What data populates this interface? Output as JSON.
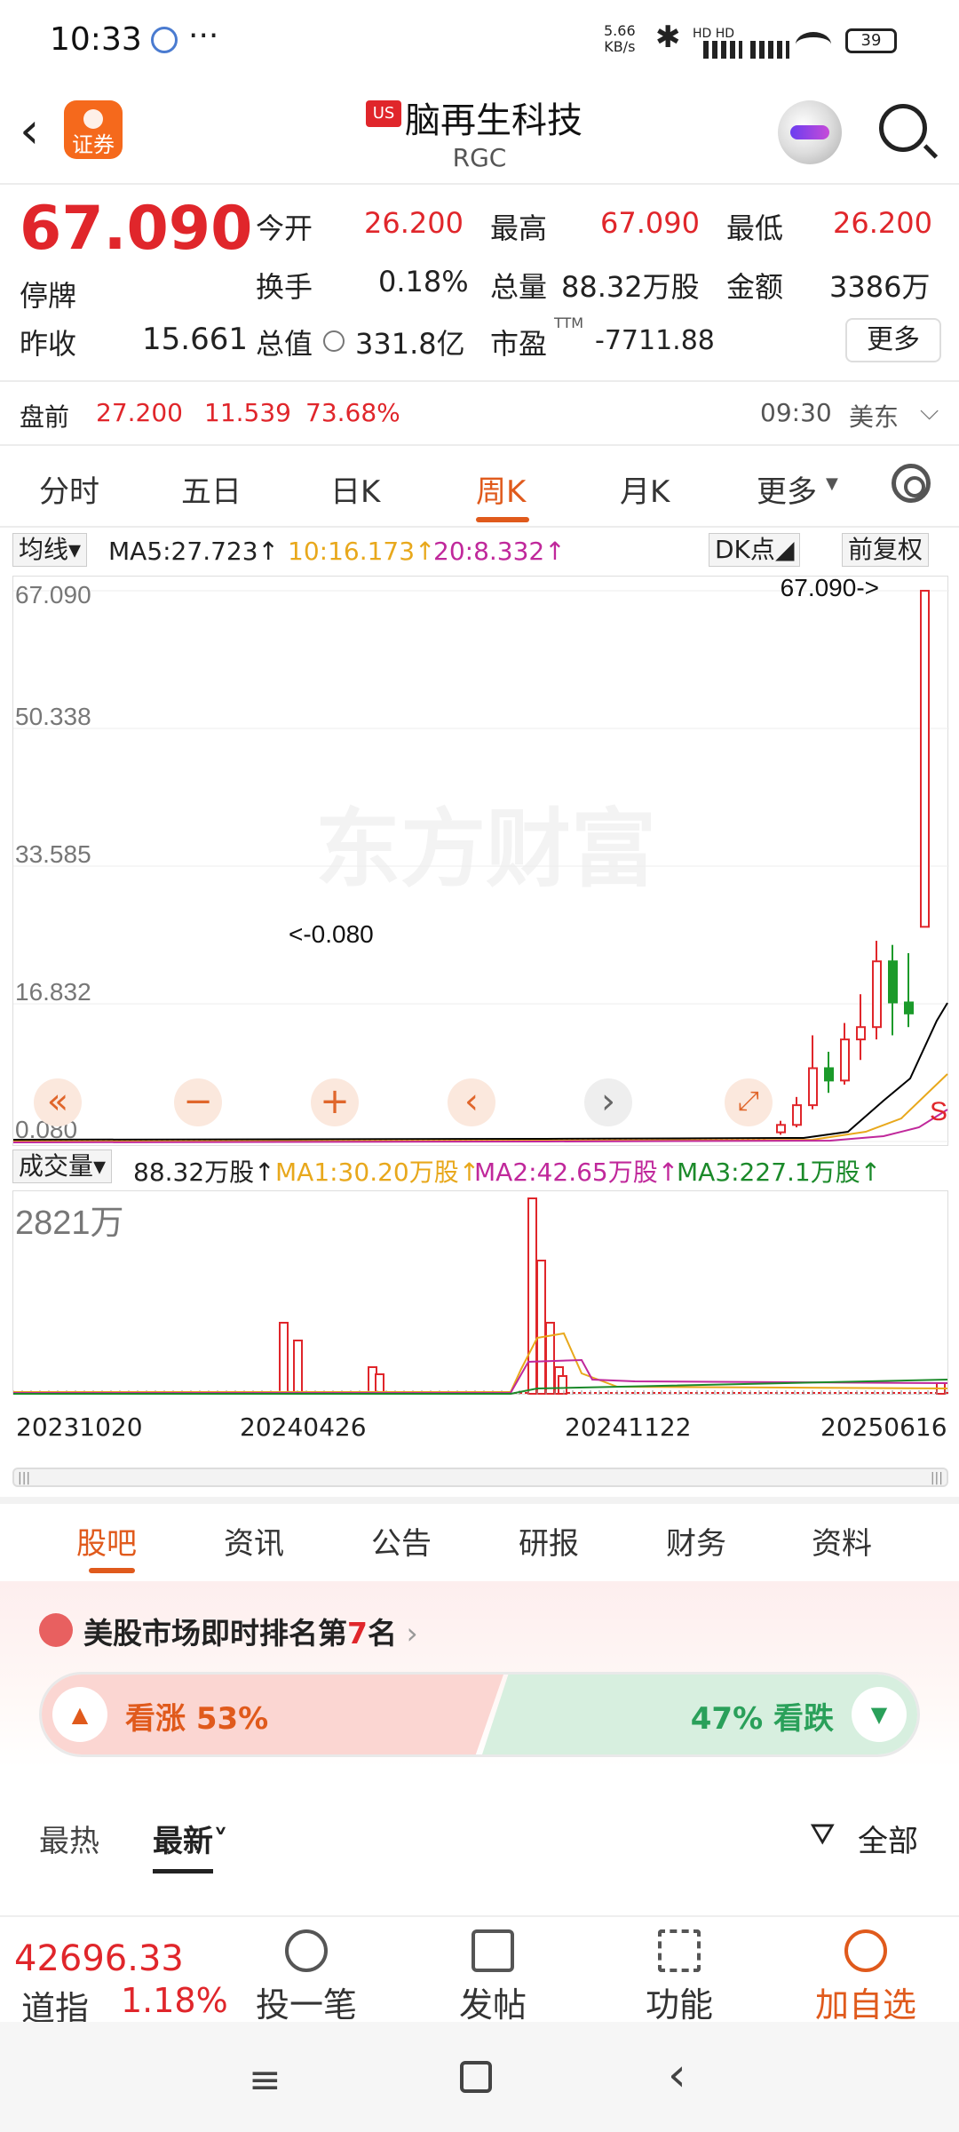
{
  "status_bar": {
    "time": "10:33",
    "net_speed": "5.66",
    "net_unit": "KB/s",
    "signal_labels": "HD HD",
    "battery": "39"
  },
  "header": {
    "brand_label": "证券",
    "market_badge": "US",
    "stock_name": "脑再生科技",
    "ticker": "RGC"
  },
  "quote": {
    "price": "67.090",
    "status": "停牌",
    "prev_close_label": "昨收",
    "prev_close": "15.661",
    "open_label": "今开",
    "open": "26.200",
    "high_label": "最高",
    "high": "67.090",
    "low_label": "最低",
    "low": "26.200",
    "turnover_label": "换手",
    "turnover": "0.18%",
    "volume_label": "总量",
    "volume": "88.32万股",
    "amount_label": "金额",
    "amount": "3386万",
    "mktcap_label": "总值",
    "mktcap": "331.8亿",
    "pe_label": "市盈",
    "pe_sup": "TTM",
    "pe": "-7711.88",
    "more": "更多"
  },
  "premarket": {
    "label": "盘前",
    "price": "27.200",
    "change": "11.539",
    "pct": "73.68%",
    "time": "09:30",
    "tz": "美东"
  },
  "chart_tabs": {
    "t1": "分时",
    "t2": "五日",
    "t3": "日K",
    "t4": "周K",
    "t5": "月K",
    "t6": "更多"
  },
  "ma_bar": {
    "kind": "均线",
    "ma5": "MA5:27.723",
    "ma10": "10:16.173",
    "ma20": "20:8.332",
    "dk": "DK点",
    "adjust": "前复权"
  },
  "price_chart": {
    "watermark": "东方财富",
    "max_marker": "67.090->",
    "min_marker": "<-0.080",
    "signal": "S"
  },
  "vol_bar": {
    "kind": "成交量",
    "vol": "88.32万股",
    "ma1": "MA1:30.20万股",
    "ma2": "MA2:42.65万股",
    "ma3": "MA3:227.1万股",
    "max": "2821万"
  },
  "dates": {
    "d1": "20231020",
    "d2": "20240426",
    "d3": "20241122",
    "d4": "20250616"
  },
  "news_tabs": {
    "t1": "股吧",
    "t2": "资讯",
    "t3": "公告",
    "t4": "研报",
    "t5": "财务",
    "t6": "资料"
  },
  "rank": {
    "prefix": "美股市场即时排名第",
    "rank": "7",
    "suffix": "名"
  },
  "vote": {
    "up_label": "看涨",
    "up_pct": "53%",
    "down_pct": "47%",
    "down_label": "看跌"
  },
  "filter": {
    "hot": "最热",
    "newest": "最新",
    "all": "全部"
  },
  "index": {
    "value": "42696.33",
    "name": "道指",
    "pct": "1.18%"
  },
  "bottom_actions": {
    "b1": "投一笔",
    "b2": "发帖",
    "b3": "功能",
    "b4": "加自选"
  },
  "chart_data": {
    "type": "candlestick",
    "y_ticks": [
      "67.090",
      "50.338",
      "33.585",
      "16.832",
      "0.080"
    ],
    "ylim": [
      0.08,
      67.09
    ],
    "x_ticks": [
      "20231020",
      "20240426",
      "20241122",
      "20250616"
    ],
    "series": [
      {
        "name": "MA5",
        "value": 27.723
      },
      {
        "name": "MA10",
        "value": 16.173
      },
      {
        "name": "MA20",
        "value": 8.332
      }
    ],
    "recent_candles": [
      {
        "open": 1.2,
        "close": 2.1,
        "low": 0.9,
        "high": 2.6
      },
      {
        "open": 2.1,
        "close": 4.5,
        "low": 1.8,
        "high": 5.5
      },
      {
        "open": 4.5,
        "close": 9.0,
        "low": 4.0,
        "high": 13.0
      },
      {
        "open": 9.0,
        "close": 7.5,
        "low": 6.0,
        "high": 11.0
      },
      {
        "open": 7.5,
        "close": 12.5,
        "low": 7.0,
        "high": 14.5
      },
      {
        "open": 12.5,
        "close": 14.0,
        "low": 10.0,
        "high": 18.0
      },
      {
        "open": 14.0,
        "close": 22.0,
        "low": 12.5,
        "high": 24.5
      },
      {
        "open": 22.0,
        "close": 17.0,
        "low": 13.0,
        "high": 24.0
      },
      {
        "open": 17.0,
        "close": 15.661,
        "low": 14.0,
        "high": 23.0
      },
      {
        "open": 26.2,
        "close": 67.09,
        "low": 26.2,
        "high": 67.09
      }
    ],
    "volume_max": "2821万"
  }
}
